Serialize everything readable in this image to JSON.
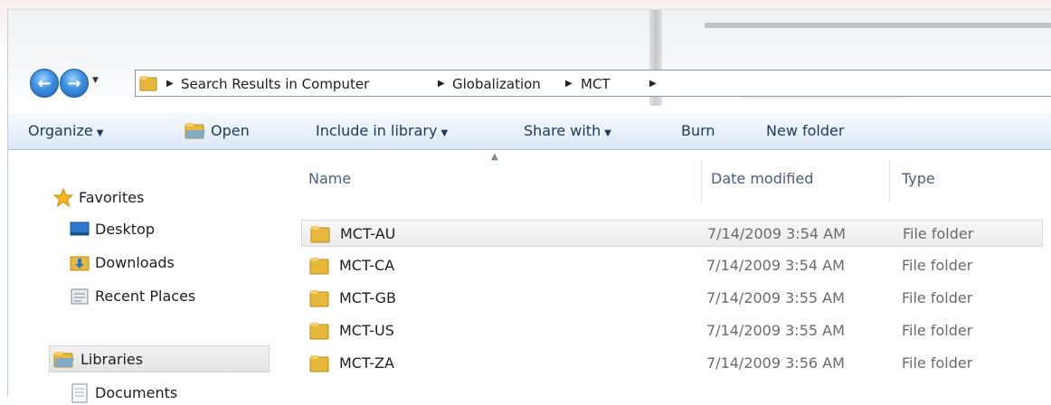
{
  "address_bar": {
    "breadcrumbs": [
      "Search Results in Computer",
      "Globalization",
      "MCT"
    ]
  },
  "toolbar": {
    "organize": "Organize",
    "open": "Open",
    "include_in_library": "Include in library",
    "share_with": "Share with",
    "burn": "Burn",
    "new_folder": "New folder"
  },
  "nav_pane": {
    "favorites": "Favorites",
    "desktop": "Desktop",
    "downloads": "Downloads",
    "recent_places": "Recent Places",
    "libraries": "Libraries",
    "documents": "Documents"
  },
  "columns": {
    "name": "Name",
    "date_modified": "Date modified",
    "type": "Type"
  },
  "files": [
    {
      "name": "MCT-AU",
      "date": "7/14/2009 3:54 AM",
      "type": "File folder",
      "selected": true
    },
    {
      "name": "MCT-CA",
      "date": "7/14/2009 3:54 AM",
      "type": "File folder"
    },
    {
      "name": "MCT-GB",
      "date": "7/14/2009 3:55 AM",
      "type": "File folder"
    },
    {
      "name": "MCT-US",
      "date": "7/14/2009 3:55 AM",
      "type": "File folder"
    },
    {
      "name": "MCT-ZA",
      "date": "7/14/2009 3:56 AM",
      "type": "File folder"
    }
  ],
  "icons": {
    "back": "back-arrow-icon",
    "forward": "forward-arrow-icon",
    "folder": "folder-icon",
    "star": "star-icon",
    "desktop": "desktop-icon",
    "downloads": "downloads-folder-icon",
    "recent": "recent-places-icon",
    "libraries": "libraries-icon",
    "documents": "document-icon"
  },
  "colors": {
    "toolbar_text": "#1e395b",
    "folder_yellow": "#e8b83a",
    "star_yellow": "#f5b81b",
    "nav_blue": "#2b78d0"
  }
}
